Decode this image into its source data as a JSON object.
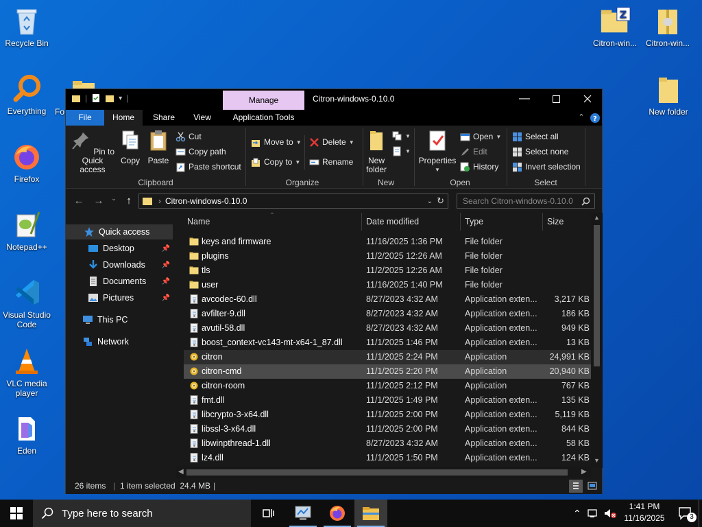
{
  "desktop": {
    "icons": [
      {
        "label": "Recycle Bin"
      },
      {
        "label": "Everything"
      },
      {
        "label": "Firefox"
      },
      {
        "label": "Notepad++"
      },
      {
        "label": "Visual Studio Code"
      },
      {
        "label": "VLC media player"
      },
      {
        "label": "Eden"
      },
      {
        "label": "Fo sh"
      },
      {
        "label": "Citron-win..."
      },
      {
        "label": "Citron-win..."
      },
      {
        "label": "New folder"
      }
    ]
  },
  "window": {
    "title": "Citron-windows-0.10.0",
    "manage_tab": "Manage",
    "tabs": {
      "file": "File",
      "home": "Home",
      "share": "Share",
      "view": "View",
      "app_tools": "Application Tools"
    },
    "ribbon": {
      "clipboard": {
        "label": "Clipboard",
        "pin": "Pin to Quick access",
        "copy": "Copy",
        "paste": "Paste",
        "cut": "Cut",
        "copy_path": "Copy path",
        "paste_shortcut": "Paste shortcut"
      },
      "organize": {
        "label": "Organize",
        "move_to": "Move to",
        "copy_to": "Copy to",
        "delete": "Delete",
        "rename": "Rename"
      },
      "new": {
        "label": "New",
        "new_folder": "New folder"
      },
      "open": {
        "label": "Open",
        "properties": "Properties",
        "open": "Open",
        "edit": "Edit",
        "history": "History"
      },
      "select": {
        "label": "Select",
        "select_all": "Select all",
        "select_none": "Select none",
        "invert": "Invert selection"
      }
    },
    "address": {
      "path": "Citron-windows-0.10.0",
      "search_placeholder": "Search Citron-windows-0.10.0"
    },
    "nav": {
      "quick_access": "Quick access",
      "desktop": "Desktop",
      "downloads": "Downloads",
      "documents": "Documents",
      "pictures": "Pictures",
      "this_pc": "This PC",
      "network": "Network"
    },
    "columns": {
      "name": "Name",
      "date": "Date modified",
      "type": "Type",
      "size": "Size"
    },
    "files": [
      {
        "name": "keys and firmware",
        "date": "11/16/2025 1:36 PM",
        "type": "File folder",
        "size": "",
        "icon": "folder"
      },
      {
        "name": "plugins",
        "date": "11/2/2025 12:26 AM",
        "type": "File folder",
        "size": "",
        "icon": "folder"
      },
      {
        "name": "tls",
        "date": "11/2/2025 12:26 AM",
        "type": "File folder",
        "size": "",
        "icon": "folder"
      },
      {
        "name": "user",
        "date": "11/16/2025 1:40 PM",
        "type": "File folder",
        "size": "",
        "icon": "folder"
      },
      {
        "name": "avcodec-60.dll",
        "date": "8/27/2023 4:32 AM",
        "type": "Application exten...",
        "size": "3,217 KB",
        "icon": "dll"
      },
      {
        "name": "avfilter-9.dll",
        "date": "8/27/2023 4:32 AM",
        "type": "Application exten...",
        "size": "186 KB",
        "icon": "dll"
      },
      {
        "name": "avutil-58.dll",
        "date": "8/27/2023 4:32 AM",
        "type": "Application exten...",
        "size": "949 KB",
        "icon": "dll"
      },
      {
        "name": "boost_context-vc143-mt-x64-1_87.dll",
        "date": "11/1/2025 1:46 PM",
        "type": "Application exten...",
        "size": "13 KB",
        "icon": "dll"
      },
      {
        "name": "citron",
        "date": "11/1/2025 2:24 PM",
        "type": "Application",
        "size": "24,991 KB",
        "icon": "app"
      },
      {
        "name": "citron-cmd",
        "date": "11/1/2025 2:20 PM",
        "type": "Application",
        "size": "20,940 KB",
        "icon": "app"
      },
      {
        "name": "citron-room",
        "date": "11/1/2025 2:12 PM",
        "type": "Application",
        "size": "767 KB",
        "icon": "app"
      },
      {
        "name": "fmt.dll",
        "date": "11/1/2025 1:49 PM",
        "type": "Application exten...",
        "size": "135 KB",
        "icon": "dll"
      },
      {
        "name": "libcrypto-3-x64.dll",
        "date": "11/1/2025 2:00 PM",
        "type": "Application exten...",
        "size": "5,119 KB",
        "icon": "dll"
      },
      {
        "name": "libssl-3-x64.dll",
        "date": "11/1/2025 2:00 PM",
        "type": "Application exten...",
        "size": "844 KB",
        "icon": "dll"
      },
      {
        "name": "libwinpthread-1.dll",
        "date": "8/27/2023 4:32 AM",
        "type": "Application exten...",
        "size": "58 KB",
        "icon": "dll"
      },
      {
        "name": "lz4.dll",
        "date": "11/1/2025 1:50 PM",
        "type": "Application exten...",
        "size": "124 KB",
        "icon": "dll"
      }
    ],
    "status": {
      "items": "26 items",
      "selected": "1 item selected  24.4 MB"
    }
  },
  "taskbar": {
    "search_placeholder": "Type here to search",
    "time": "1:41 PM",
    "date": "11/16/2025",
    "notifications": "3"
  },
  "colors": {
    "file_tab": "#1a6fcf",
    "manage_tab": "#e6c7f2",
    "desktop": "#0a5bc4"
  }
}
